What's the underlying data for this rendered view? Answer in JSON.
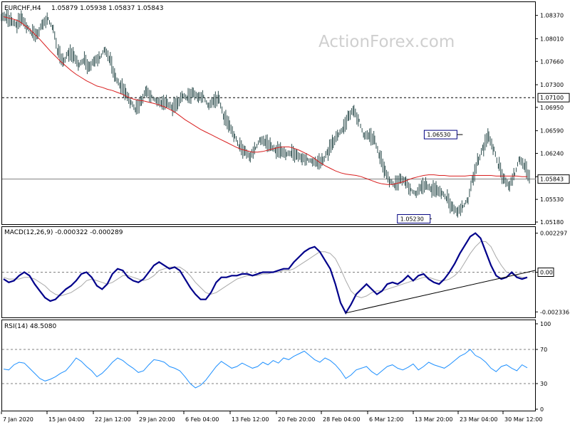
{
  "header": {
    "symbol": "EURCHF,H4",
    "ohlc": "1.05879 1.05938 1.05837 1.05843"
  },
  "watermark": "ActionForex.com",
  "colors": {
    "price_bars": "#2f4f4f",
    "moving_average": "#d91f1f",
    "macd_main": "#00008b",
    "macd_signal": "#a9a9a9",
    "rsi_line": "#1e90ff",
    "grid": "#808080",
    "label_bg": "#ffffff"
  },
  "chart_data": [
    {
      "type": "line",
      "title": "",
      "xlabel": "",
      "ylabel": "",
      "ylim": [
        1.0518,
        1.0852
      ],
      "x_ticks": [
        "7 Jan 2020",
        "15 Jan 04:00",
        "22 Jan 12:00",
        "29 Jan 20:00",
        "6 Feb 04:00",
        "13 Feb 12:00",
        "20 Feb 20:00",
        "28 Feb 04:00",
        "6 Mar 12:00",
        "13 Mar 20:00",
        "23 Mar 04:00",
        "30 Mar 12:00"
      ],
      "y_ticks": [
        "1.08370",
        "1.08010",
        "1.07660",
        "1.07300",
        "1.06950",
        "1.06590",
        "1.06240",
        "1.05880",
        "1.05530",
        "1.05180"
      ],
      "horizontal_lines": [
        {
          "value": 1.071,
          "label": "1.07100",
          "style": "dashed"
        }
      ],
      "last_price": {
        "value": 1.05843,
        "label": "1.05843"
      },
      "annotations": [
        {
          "label": "1.06530",
          "value": 1.0653,
          "date": "24 Mar"
        },
        {
          "label": "1.05230",
          "value": 1.0523,
          "date": "16 Mar"
        }
      ],
      "series": [
        {
          "kind": "price_bars",
          "values": [
            1.0835,
            1.0828,
            1.0822,
            1.083,
            1.0818,
            1.081,
            1.0808,
            1.0825,
            1.0832,
            1.0818,
            1.0782,
            1.0765,
            1.0778,
            1.0772,
            1.076,
            1.0768,
            1.0758,
            1.0768,
            1.0772,
            1.0784,
            1.077,
            1.0742,
            1.0728,
            1.0715,
            1.0702,
            1.0692,
            1.0705,
            1.0722,
            1.0712,
            1.0705,
            1.0702,
            1.0702,
            1.0694,
            1.0698,
            1.0712,
            1.071,
            1.0718,
            1.0712,
            1.0712,
            1.0698,
            1.0705,
            1.0708,
            1.068,
            1.0665,
            1.065,
            1.0635,
            1.0628,
            1.062,
            1.0632,
            1.0645,
            1.0642,
            1.0635,
            1.0628,
            1.0625,
            1.0622,
            1.0625,
            1.0622,
            1.0618,
            1.0615,
            1.0612,
            1.061,
            1.0612,
            1.0625,
            1.0638,
            1.0652,
            1.0662,
            1.0682,
            1.0692,
            1.0675,
            1.0652,
            1.0652,
            1.0645,
            1.062,
            1.0595,
            1.058,
            1.0575,
            1.0585,
            1.0582,
            1.0568,
            1.0562,
            1.0572,
            1.0575,
            1.0568,
            1.0565,
            1.0562,
            1.0555,
            1.0542,
            1.0535,
            1.0542,
            1.0552,
            1.0585,
            1.0612,
            1.0632,
            1.0648,
            1.063,
            1.0605,
            1.0585,
            1.0575,
            1.0592,
            1.0615,
            1.0605,
            1.0585
          ]
        },
        {
          "kind": "moving_average",
          "values": [
            1.0835,
            1.0833,
            1.0831,
            1.0828,
            1.0822,
            1.0816,
            1.0808,
            1.08,
            1.0791,
            1.0782,
            1.0774,
            1.0766,
            1.0759,
            1.0752,
            1.0746,
            1.0741,
            1.0736,
            1.0732,
            1.0728,
            1.0726,
            1.0723,
            1.0721,
            1.0718,
            1.0715,
            1.0711,
            1.0708,
            1.0706,
            1.0705,
            1.0703,
            1.0701,
            1.0699,
            1.0696,
            1.0692,
            1.0688,
            1.0682,
            1.0676,
            1.0671,
            1.0666,
            1.0661,
            1.0657,
            1.0653,
            1.0649,
            1.0645,
            1.0641,
            1.0637,
            1.0633,
            1.063,
            1.0628,
            1.0626,
            1.0626,
            1.0627,
            1.0629,
            1.0631,
            1.0633,
            1.0634,
            1.0634,
            1.0632,
            1.0629,
            1.0625,
            1.0621,
            1.0616,
            1.061,
            1.0605,
            1.0601,
            1.0597,
            1.0594,
            1.0592,
            1.0591,
            1.059,
            1.0588,
            1.0585,
            1.0582,
            1.0579,
            1.0577,
            1.0576,
            1.0576,
            1.0578,
            1.058,
            1.0583,
            1.0586,
            1.0588,
            1.059,
            1.0591,
            1.0591,
            1.059,
            1.059,
            1.0589,
            1.0589,
            1.0589,
            1.0589,
            1.059,
            1.059,
            1.059,
            1.059,
            1.059,
            1.0589,
            1.0589,
            1.0589,
            1.0589,
            1.0589,
            1.0588,
            1.0588
          ]
        }
      ]
    },
    {
      "type": "line",
      "title": "MACD(12,26,9) -0.000322 -0.000289",
      "xlabel": "",
      "ylabel": "",
      "ylim": [
        -0.00245,
        0.00245
      ],
      "y_ticks": [
        "0.002297",
        "0.00",
        "-0.002336"
      ],
      "signal_label": "0.00",
      "series": [
        {
          "kind": "macd_main",
          "values": [
            -0.0004,
            -0.0006,
            -0.0005,
            -0.0002,
            0.0,
            -0.0002,
            -0.0007,
            -0.0011,
            -0.0015,
            -0.0017,
            -0.0016,
            -0.0013,
            -0.001,
            -0.0008,
            -0.0005,
            -0.0001,
            0.0,
            -0.0003,
            -0.0008,
            -0.001,
            -0.0007,
            -0.0001,
            0.0002,
            0.0001,
            -0.0003,
            -0.0005,
            -0.0006,
            -0.0004,
            0.0,
            0.0004,
            0.0006,
            0.0004,
            0.0002,
            0.0003,
            0.0001,
            -0.0004,
            -0.0009,
            -0.0013,
            -0.0016,
            -0.0016,
            -0.0012,
            -0.0006,
            -0.0003,
            -0.0003,
            -0.0002,
            -0.0002,
            -0.0001,
            -0.0001,
            -0.0002,
            -0.0001,
            0.0,
            0.0,
            0.0,
            0.0001,
            0.0002,
            0.0002,
            0.0006,
            0.0009,
            0.0012,
            0.0014,
            0.0015,
            0.0012,
            0.0007,
            0.0002,
            -0.0007,
            -0.0018,
            -0.0024,
            -0.0019,
            -0.0013,
            -0.001,
            -0.0007,
            -0.001,
            -0.0013,
            -0.0011,
            -0.0007,
            -0.0006,
            -0.0007,
            -0.0005,
            -0.0002,
            -0.0005,
            -0.0002,
            -0.0001,
            -0.0004,
            -0.0006,
            -0.0007,
            -0.0004,
            0.0,
            0.0005,
            0.0011,
            0.0016,
            0.0021,
            0.0023,
            0.002,
            0.0012,
            0.0004,
            -0.0002,
            -0.0004,
            -0.0003,
            0.0,
            -0.0003,
            -0.0004,
            -0.0003
          ]
        },
        {
          "kind": "macd_signal",
          "values": [
            -0.0003,
            -0.0004,
            -0.0004,
            -0.0004,
            -0.0003,
            -0.0003,
            -0.0004,
            -0.0006,
            -0.0008,
            -0.0011,
            -0.0013,
            -0.0014,
            -0.0013,
            -0.0012,
            -0.001,
            -0.0008,
            -0.0005,
            -0.0004,
            -0.0005,
            -0.0006,
            -0.0007,
            -0.0006,
            -0.0004,
            -0.0002,
            -0.0002,
            -0.0003,
            -0.0004,
            -0.0005,
            -0.0004,
            -0.0002,
            0.0001,
            0.0002,
            0.0003,
            0.0003,
            0.0003,
            0.0001,
            -0.0002,
            -0.0006,
            -0.0009,
            -0.0012,
            -0.0013,
            -0.0012,
            -0.001,
            -0.0008,
            -0.0006,
            -0.0004,
            -0.0003,
            -0.0002,
            -0.0002,
            -0.0002,
            -0.0001,
            -0.0001,
            0.0,
            0.0,
            0.0001,
            0.0001,
            0.0002,
            0.0004,
            0.0006,
            0.0008,
            0.001,
            0.0012,
            0.0012,
            0.0011,
            0.0008,
            0.0002,
            -0.0005,
            -0.0011,
            -0.0014,
            -0.0015,
            -0.0014,
            -0.0012,
            -0.0011,
            -0.0011,
            -0.001,
            -0.0009,
            -0.0008,
            -0.0007,
            -0.0006,
            -0.0005,
            -0.0004,
            -0.0003,
            -0.0003,
            -0.0004,
            -0.0005,
            -0.0005,
            -0.0004,
            -0.0002,
            0.0001,
            0.0006,
            0.0011,
            0.0015,
            0.0018,
            0.0018,
            0.0015,
            0.0009,
            0.0004,
            0.0,
            -0.0001,
            -0.0002,
            -0.0003,
            -0.0003
          ]
        }
      ]
    },
    {
      "type": "line",
      "title": "RSI(14) 48.5080",
      "xlabel": "",
      "ylabel": "",
      "ylim": [
        0,
        100
      ],
      "y_ticks": [
        "100",
        "70",
        "30",
        "0"
      ],
      "reference_levels": [
        70,
        30
      ],
      "series": [
        {
          "kind": "rsi",
          "values": [
            47,
            46,
            52,
            55,
            54,
            48,
            42,
            36,
            33,
            35,
            38,
            42,
            45,
            52,
            60,
            56,
            50,
            45,
            38,
            42,
            48,
            55,
            60,
            57,
            52,
            48,
            43,
            45,
            52,
            58,
            57,
            55,
            50,
            48,
            45,
            38,
            30,
            25,
            28,
            34,
            42,
            50,
            56,
            52,
            48,
            50,
            54,
            51,
            48,
            50,
            55,
            52,
            57,
            54,
            60,
            58,
            62,
            65,
            68,
            63,
            58,
            55,
            60,
            57,
            52,
            45,
            36,
            40,
            46,
            48,
            50,
            44,
            40,
            45,
            50,
            52,
            48,
            46,
            49,
            53,
            46,
            50,
            55,
            52,
            50,
            48,
            52,
            57,
            62,
            65,
            70,
            63,
            60,
            55,
            48,
            44,
            50,
            52,
            48,
            45,
            52,
            48.5
          ]
        }
      ]
    }
  ]
}
